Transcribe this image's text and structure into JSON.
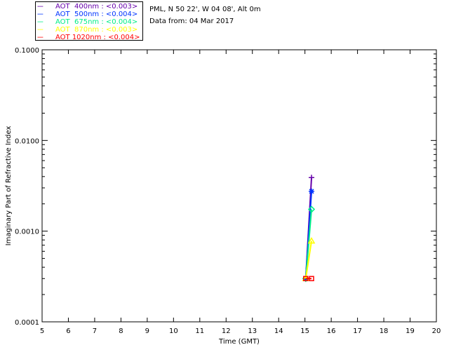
{
  "header": {
    "site": "PML, N 50 22', W 04 08', Alt 0m",
    "date": "Data from: 04 Mar 2017"
  },
  "chart_data": {
    "type": "line",
    "xlabel": "Time (GMT)",
    "ylabel": "Imaginary Part of Refractive Index",
    "xlim": [
      5,
      20
    ],
    "ylim": [
      0.0001,
      0.1
    ],
    "yscale": "log",
    "xticks": [
      "5",
      "6",
      "7",
      "8",
      "9",
      "10",
      "11",
      "12",
      "13",
      "14",
      "15",
      "16",
      "17",
      "18",
      "19",
      "20"
    ],
    "yticks": [
      "0.0001",
      "0.0010",
      "0.0100",
      "0.1000"
    ],
    "legend_position": "top-left outside",
    "series": [
      {
        "name": "AOT  400nm : <0.003>",
        "color": "#6600aa",
        "marker": "plus",
        "x": [
          15.03,
          15.25
        ],
        "y": [
          0.0003,
          0.0039
        ]
      },
      {
        "name": "AOT  500nm : <0.004>",
        "color": "#0033ff",
        "marker": "asterisk",
        "x": [
          15.03,
          15.25
        ],
        "y": [
          0.0003,
          0.00275
        ]
      },
      {
        "name": "AOT  675nm : <0.004>",
        "color": "#00ee88",
        "marker": "diamond",
        "x": [
          15.03,
          15.25
        ],
        "y": [
          0.0003,
          0.00174
        ]
      },
      {
        "name": "AOT  870nm : <0.003>",
        "color": "#ffff00",
        "marker": "triangle",
        "x": [
          15.03,
          15.25
        ],
        "y": [
          0.0003,
          0.00078
        ]
      },
      {
        "name": "AOT 1020nm : <0.004>",
        "color": "#ff0000",
        "marker": "square",
        "x": [
          15.03,
          15.25
        ],
        "y": [
          0.0003,
          0.0003
        ]
      }
    ]
  }
}
